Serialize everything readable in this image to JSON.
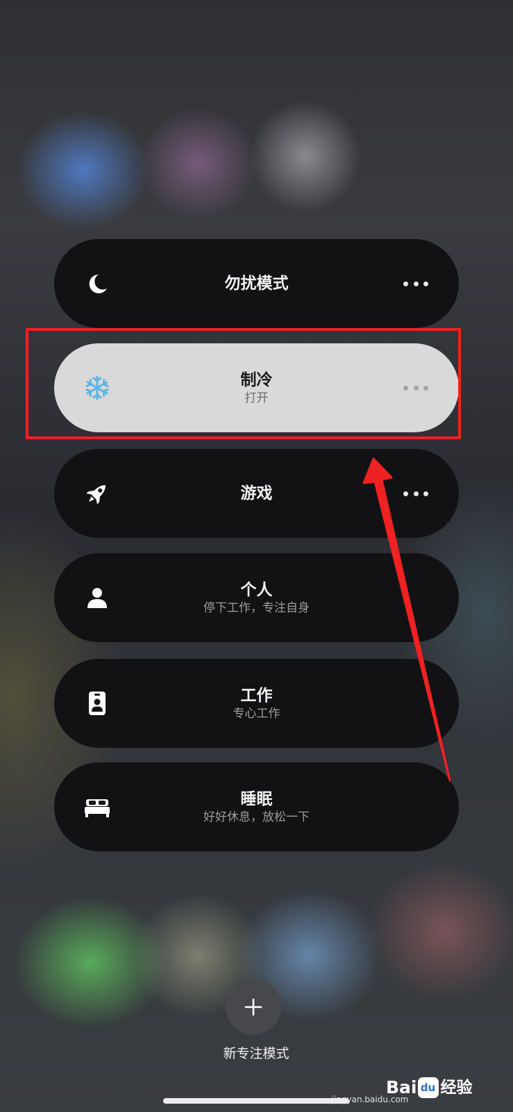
{
  "modes": [
    {
      "key": "dnd",
      "name": "勿扰模式",
      "subtitle": "",
      "icon": "moon-icon",
      "has_more": true,
      "active": false
    },
    {
      "key": "cooling",
      "name": "制冷",
      "subtitle": "打开",
      "icon": "snowflake-icon",
      "has_more": true,
      "active": true
    },
    {
      "key": "gaming",
      "name": "游戏",
      "subtitle": "",
      "icon": "rocket-icon",
      "has_more": true,
      "active": false
    },
    {
      "key": "personal",
      "name": "个人",
      "subtitle": "停下工作，专注自身",
      "icon": "person-icon",
      "has_more": false,
      "active": false
    },
    {
      "key": "work",
      "name": "工作",
      "subtitle": "专心工作",
      "icon": "id-badge-icon",
      "has_more": false,
      "active": false
    },
    {
      "key": "sleep",
      "name": "睡眠",
      "subtitle": "好好休息，放松一下",
      "icon": "bed-icon",
      "has_more": false,
      "active": false
    }
  ],
  "add_mode": {
    "label": "新专注模式",
    "icon": "plus-icon"
  },
  "annotations": {
    "highlight_color": "#ee2222"
  },
  "watermark": {
    "brand_a": "Bai",
    "brand_paw": "du",
    "brand_b": "经验",
    "url": "jingyan.baidu.com"
  },
  "colors": {
    "card_background": "#121214",
    "active_card_background": "#d9d9d9",
    "snowflake": "#5ab4e6"
  }
}
